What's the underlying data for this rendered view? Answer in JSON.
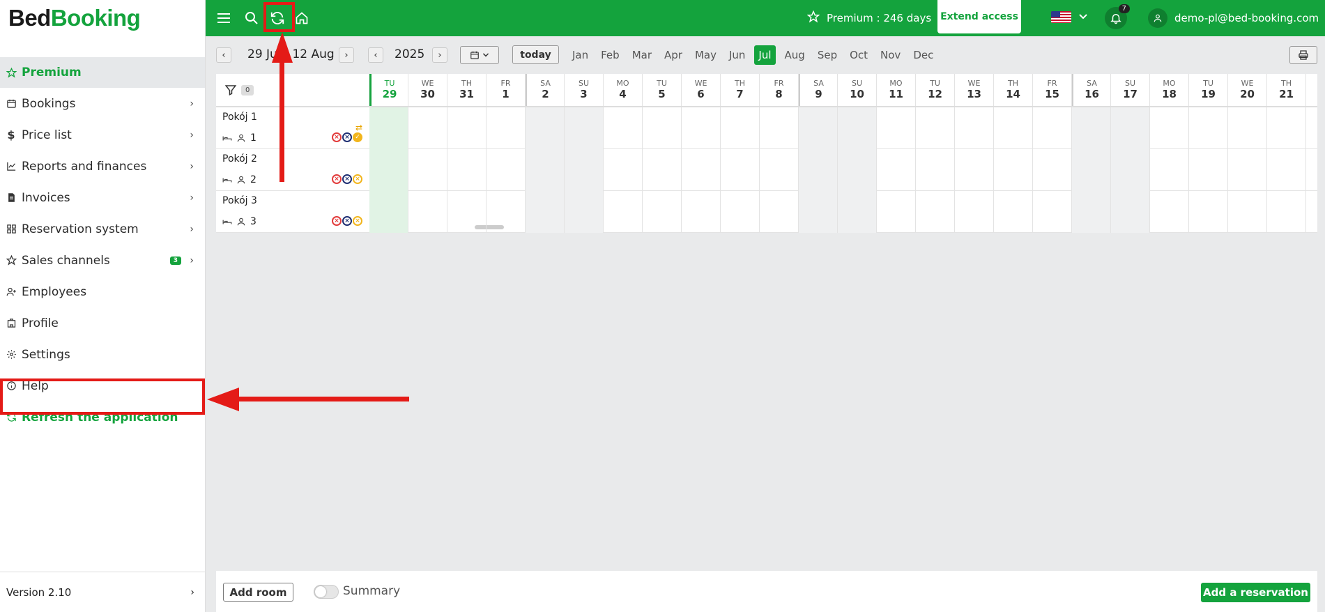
{
  "brand": {
    "part1": "Bed",
    "part2": "Booking"
  },
  "sidebar": {
    "items": [
      {
        "label": "Premium",
        "icon": "star-icon",
        "chevron": false
      },
      {
        "label": "Bookings",
        "icon": "calendar-icon",
        "chevron": true
      },
      {
        "label": "Price list",
        "icon": "dollar-icon",
        "chevron": true
      },
      {
        "label": "Reports and finances",
        "icon": "chart-icon",
        "chevron": true
      },
      {
        "label": "Invoices",
        "icon": "invoice-icon",
        "chevron": true
      },
      {
        "label": "Reservation system",
        "icon": "grid-icon",
        "chevron": true
      },
      {
        "label": "Sales channels",
        "icon": "star-outline-icon",
        "chevron": true,
        "badge": "3"
      },
      {
        "label": "Employees",
        "icon": "user-plus-icon",
        "chevron": false
      },
      {
        "label": "Profile",
        "icon": "building-icon",
        "chevron": false
      },
      {
        "label": "Settings",
        "icon": "gear-icon",
        "chevron": false
      },
      {
        "label": "Help",
        "icon": "info-icon",
        "chevron": false
      },
      {
        "label": "Refresh the application",
        "icon": "refresh-icon",
        "chevron": false
      }
    ],
    "version": "Version 2.10"
  },
  "topbar": {
    "premium_text": "Premium : 246 days",
    "extend_label": "Extend access",
    "notifications": "7",
    "user_email": "demo-pl@bed-booking.com"
  },
  "datenav": {
    "range": "29 Jul - 12 Aug",
    "year": "2025",
    "today_label": "today",
    "months": [
      "Jan",
      "Feb",
      "Mar",
      "Apr",
      "May",
      "Jun",
      "Jul",
      "Aug",
      "Sep",
      "Oct",
      "Nov",
      "Dec"
    ],
    "active_month": "Jul"
  },
  "grid": {
    "filter_count": "0",
    "days": [
      {
        "dn": "TU",
        "dd": "29",
        "today": true
      },
      {
        "dn": "WE",
        "dd": "30"
      },
      {
        "dn": "TH",
        "dd": "31"
      },
      {
        "dn": "FR",
        "dd": "1"
      },
      {
        "dn": "SA",
        "dd": "2",
        "weekend": true
      },
      {
        "dn": "SU",
        "dd": "3",
        "weekend": true
      },
      {
        "dn": "MO",
        "dd": "4"
      },
      {
        "dn": "TU",
        "dd": "5"
      },
      {
        "dn": "WE",
        "dd": "6"
      },
      {
        "dn": "TH",
        "dd": "7"
      },
      {
        "dn": "FR",
        "dd": "8"
      },
      {
        "dn": "SA",
        "dd": "9",
        "weekend": true
      },
      {
        "dn": "SU",
        "dd": "10",
        "weekend": true
      },
      {
        "dn": "MO",
        "dd": "11"
      },
      {
        "dn": "TU",
        "dd": "12"
      },
      {
        "dn": "WE",
        "dd": "13"
      },
      {
        "dn": "TH",
        "dd": "14"
      },
      {
        "dn": "FR",
        "dd": "15"
      },
      {
        "dn": "SA",
        "dd": "16",
        "weekend": true
      },
      {
        "dn": "SU",
        "dd": "17",
        "weekend": true
      },
      {
        "dn": "MO",
        "dd": "18"
      },
      {
        "dn": "TU",
        "dd": "19"
      },
      {
        "dn": "WE",
        "dd": "20"
      },
      {
        "dn": "TH",
        "dd": "21"
      }
    ],
    "rooms": [
      {
        "name": "Pokój 1",
        "guests": "1"
      },
      {
        "name": "Pokój 2",
        "guests": "2"
      },
      {
        "name": "Pokój 3",
        "guests": "3"
      }
    ]
  },
  "bottombar": {
    "add_room": "Add room",
    "summary": "Summary",
    "add_reservation": "Add a reservation"
  },
  "colors": {
    "brand_green": "#14a33d",
    "highlight_red": "#e41b17"
  }
}
